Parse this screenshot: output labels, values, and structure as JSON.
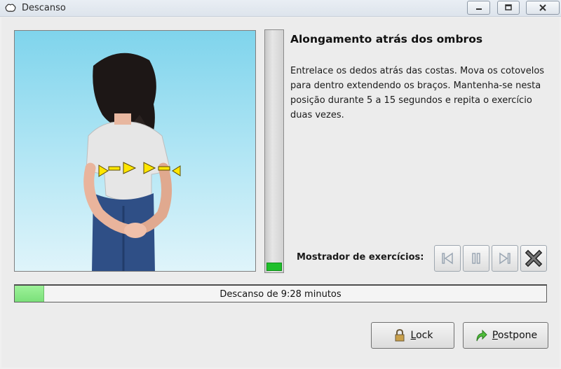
{
  "window": {
    "title": "Descanso"
  },
  "exercise": {
    "title": "Alongamento atrás dos ombros",
    "description": "Entrelace os dedos atrás das costas. Mova os cotovelos para dentro extendendo os braços. Mantenha-se nesta posição durante 5 a 15 segundos e repita o exercício duas vezes.",
    "hold_progress": 0.04
  },
  "viewer": {
    "label": "Mostrador de exercícios:",
    "controls": [
      "previous",
      "pause",
      "next",
      "stop"
    ]
  },
  "rest": {
    "text": "Descanso de 9:28 minutos",
    "progress": 0.055
  },
  "buttons": {
    "lock": {
      "mnemonic": "L",
      "rest": "ock"
    },
    "postpone": {
      "mnemonic": "P",
      "rest": "ostpone"
    }
  },
  "icons": [
    "app-icon",
    "minimize-icon",
    "maximize-icon",
    "close-icon",
    "skip-back-icon",
    "pause-icon",
    "skip-forward-icon",
    "stop-icon",
    "lock-icon",
    "postpone-arrow-icon"
  ],
  "colors": {
    "progress_fill": "#8ee58b",
    "level_fill": "#1fbf2b",
    "sky_top": "#7fd4ec",
    "arrow": "#ffe000"
  }
}
